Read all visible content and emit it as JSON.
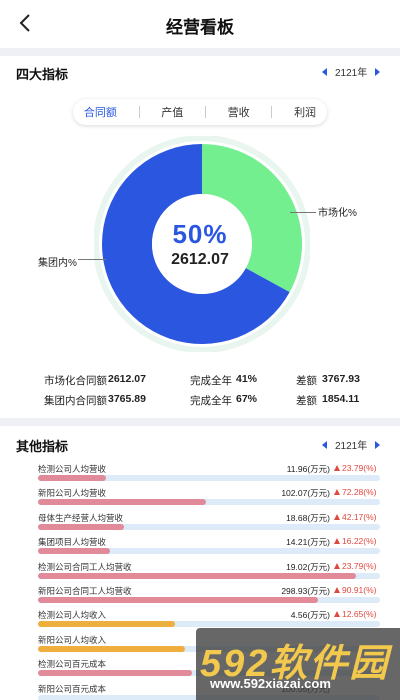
{
  "header": {
    "title": "经营看板"
  },
  "section1": {
    "title": "四大指标",
    "year": "2121年",
    "tabs": [
      {
        "label": "合同额",
        "active": true
      },
      {
        "label": "产值",
        "active": false
      },
      {
        "label": "营收",
        "active": false
      },
      {
        "label": "利润",
        "active": false
      }
    ],
    "donut": {
      "center_percent": "50%",
      "center_value": "2612.07",
      "market_label": "市场化%",
      "group_label": "集团内%",
      "market_share": 0.33,
      "market_color": "#74ef8f",
      "group_color": "#2b57e0"
    },
    "stats": [
      {
        "label": "市场化合同额",
        "value": "2612.07",
        "done_label": "完成全年",
        "done_value": "41%",
        "diff_label": "差额",
        "diff_value": "3767.93"
      },
      {
        "label": "集团内合同额",
        "value": "3765.89",
        "done_label": "完成全年",
        "done_value": "67%",
        "diff_label": "差额",
        "diff_value": "1854.11"
      }
    ]
  },
  "section2": {
    "title": "其他指标",
    "year": "2121年",
    "indicators": [
      {
        "label": "检测公司人均营收",
        "value": "11.96(万元)",
        "change": "23.79(%)",
        "fill": 0.2,
        "color": "#e08a9a"
      },
      {
        "label": "新阳公司人均营收",
        "value": "102.07(万元)",
        "change": "72.28(%)",
        "fill": 0.49,
        "color": "#e08a9a"
      },
      {
        "label": "母体生产经营人均营收",
        "value": "18.68(万元)",
        "change": "42.17(%)",
        "fill": 0.25,
        "color": "#e08a9a"
      },
      {
        "label": "集团项目人均营收",
        "value": "14.21(万元)",
        "change": "16.22(%)",
        "fill": 0.21,
        "color": "#e08a9a"
      },
      {
        "label": "检测公司合同工人均营收",
        "value": "19.02(万元)",
        "change": "23.79(%)",
        "fill": 0.93,
        "color": "#e08a9a"
      },
      {
        "label": "新阳公司合同工人均营收",
        "value": "298.93(万元)",
        "change": "90.91(%)",
        "fill": 0.82,
        "color": "#e08a9a"
      },
      {
        "label": "检测公司人均收入",
        "value": "4.56(万元)",
        "change": "12.65(%)",
        "fill": 0.4,
        "color": "#efaf3f"
      },
      {
        "label": "新阳公司人均收入",
        "value": "",
        "change": "",
        "fill": 0.43,
        "color": "#efaf3f"
      },
      {
        "label": "检测公司百元成本",
        "value": "",
        "change": "",
        "fill": 0.45,
        "color": "#e08a9a"
      },
      {
        "label": "新阳公司百元成本",
        "value": "100.05(万元)",
        "change": "",
        "fill": 0.0,
        "color": "#e08a9a"
      }
    ]
  },
  "watermark": {
    "brand": "592软件园",
    "url": "www.592xiazai.com"
  }
}
